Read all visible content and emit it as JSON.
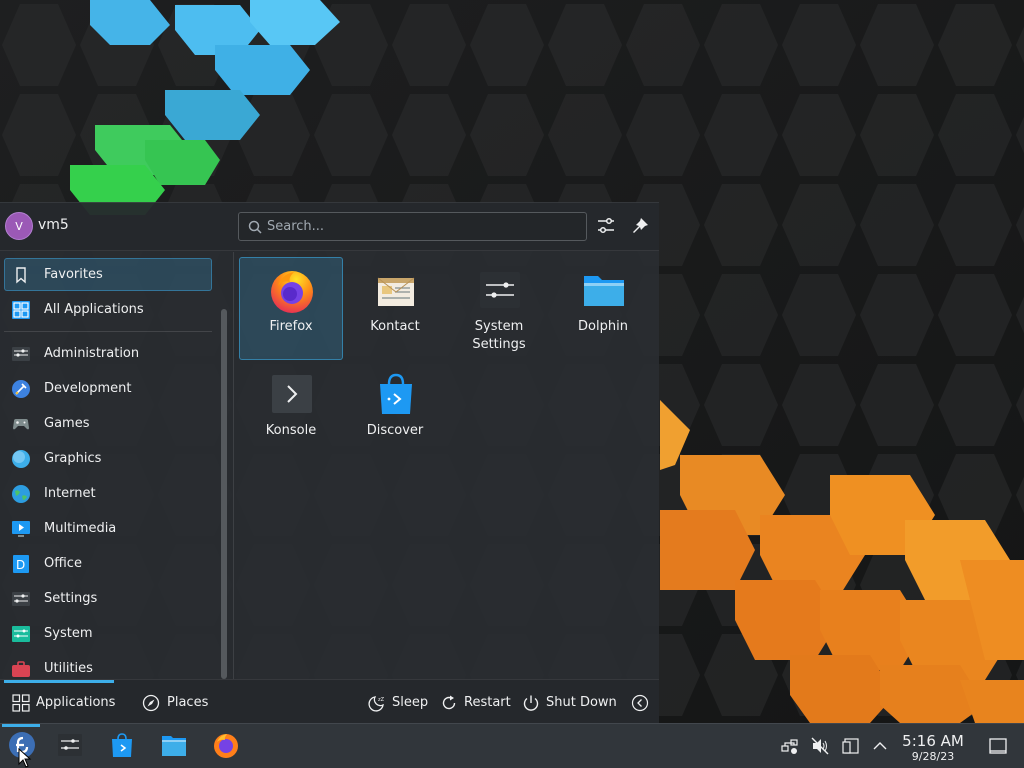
{
  "user": {
    "name": "vm5",
    "initial": "V"
  },
  "search": {
    "placeholder": "Search..."
  },
  "sidebar": {
    "items": [
      {
        "label": "Favorites",
        "icon": "bookmark-icon",
        "selected": true
      },
      {
        "label": "All Applications",
        "icon": "grid-icon",
        "selected": false
      },
      {
        "label": "Administration",
        "icon": "admin-icon",
        "selected": false
      },
      {
        "label": "Development",
        "icon": "development-icon",
        "selected": false
      },
      {
        "label": "Games",
        "icon": "gamepad-icon",
        "selected": false
      },
      {
        "label": "Graphics",
        "icon": "graphics-icon",
        "selected": false
      },
      {
        "label": "Internet",
        "icon": "globe-icon",
        "selected": false
      },
      {
        "label": "Multimedia",
        "icon": "multimedia-icon",
        "selected": false
      },
      {
        "label": "Office",
        "icon": "office-icon",
        "selected": false
      },
      {
        "label": "Settings",
        "icon": "settings-icon",
        "selected": false
      },
      {
        "label": "System",
        "icon": "system-icon",
        "selected": false
      },
      {
        "label": "Utilities",
        "icon": "utilities-icon",
        "selected": false
      }
    ]
  },
  "favorites": [
    {
      "label": "Firefox",
      "icon": "firefox-icon",
      "selected": true
    },
    {
      "label": "Kontact",
      "icon": "kontact-icon",
      "selected": false
    },
    {
      "label": "System Settings",
      "icon": "system-settings-icon",
      "selected": false
    },
    {
      "label": "Dolphin",
      "icon": "folder-icon",
      "selected": false
    },
    {
      "label": "Konsole",
      "icon": "terminal-icon",
      "selected": false
    },
    {
      "label": "Discover",
      "icon": "discover-icon",
      "selected": false
    }
  ],
  "footer": {
    "applications": "Applications",
    "places": "Places",
    "sleep": "Sleep",
    "restart": "Restart",
    "shutdown": "Shut Down"
  },
  "taskbar": {
    "tasks": [
      "app-launcher-icon",
      "system-settings-icon",
      "discover-icon",
      "folder-icon",
      "firefox-icon"
    ]
  },
  "tray": {
    "icons": [
      "network-icon",
      "volume-muted-icon",
      "clipboard-icon",
      "expand-tray-icon"
    ]
  },
  "clock": {
    "time": "5:16 AM",
    "date": "9/28/23"
  },
  "colors": {
    "accent": "#3daee9",
    "panel": "#31363b",
    "wallpaper_blue": "#45b4e8",
    "wallpaper_green": "#35d04c",
    "wallpaper_orange": "#e87f1f"
  }
}
